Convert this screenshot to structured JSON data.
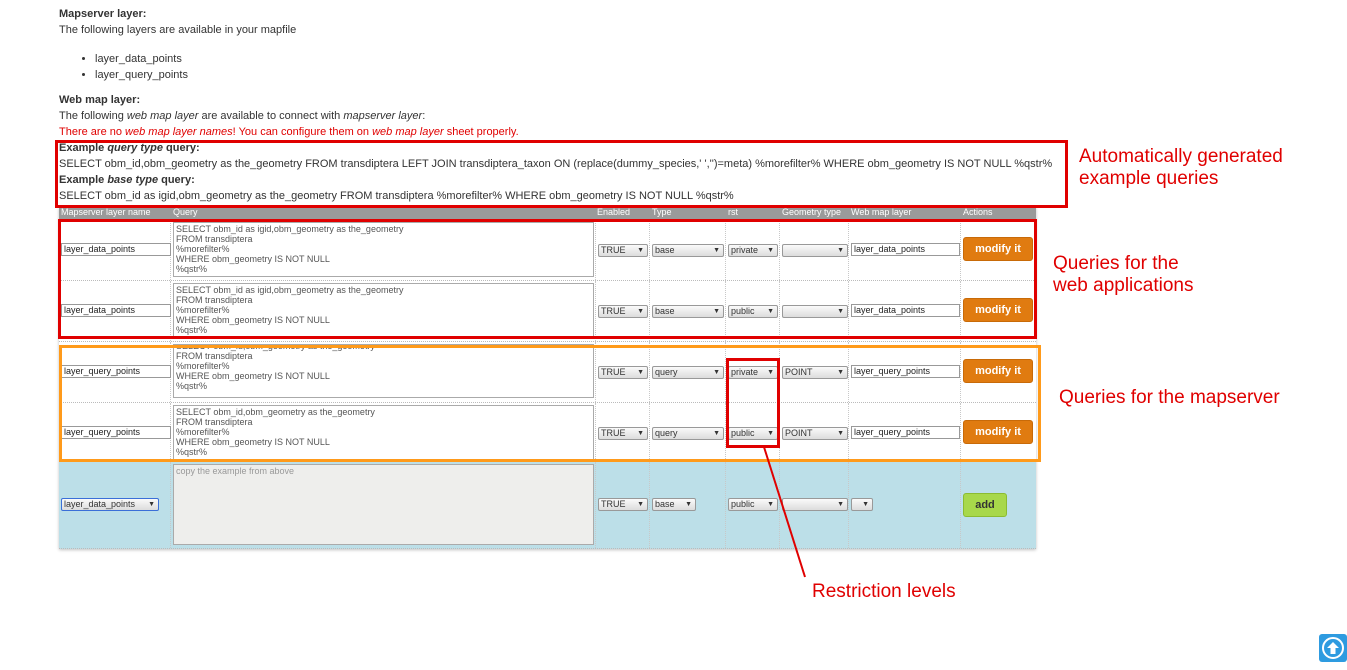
{
  "mapserver": {
    "heading": "Mapserver layer:",
    "intro": "The following layers are available in your mapfile",
    "layers": [
      "layer_data_points",
      "layer_query_points"
    ]
  },
  "webmap": {
    "heading": "Web map layer:",
    "intro_a": "The following ",
    "intro_b": "web map layer",
    "intro_c": " are available to connect with ",
    "intro_d": "mapserver layer",
    "intro_e": ":",
    "warn_a": "There are no ",
    "warn_b": "web map layer names",
    "warn_c": "! You can configure them on ",
    "warn_d": "web map layer",
    "warn_e": " sheet properly."
  },
  "examples": {
    "query_label_a": "Example ",
    "query_label_b": "query type",
    "query_label_c": " query:",
    "query_sql": "SELECT obm_id,obm_geometry as the_geometry FROM transdiptera LEFT JOIN transdiptera_taxon ON (replace(dummy_species,' ','')=meta) %morefilter% WHERE obm_geometry IS NOT NULL %qstr%",
    "base_label_a": "Example ",
    "base_label_b": "base type",
    "base_label_c": " query:",
    "base_sql": "SELECT obm_id as igid,obm_geometry as the_geometry FROM transdiptera %morefilter% WHERE obm_geometry IS NOT NULL %qstr%"
  },
  "table": {
    "headers": [
      "Mapserver layer name",
      "Query",
      "Enabled",
      "Type",
      "rst",
      "Geometry type",
      "Web map layer",
      "Actions"
    ],
    "rows": [
      {
        "layer": "layer_data_points",
        "query": "SELECT obm_id as igid,obm_geometry as the_geometry\nFROM transdiptera\n%morefilter%\nWHERE obm_geometry IS NOT NULL\n%qstr%",
        "enabled": "TRUE",
        "type": "base",
        "rst": "private",
        "geom": "",
        "webmap": "layer_data_points",
        "action": "modify it"
      },
      {
        "layer": "layer_data_points",
        "query": "SELECT obm_id as igid,obm_geometry as the_geometry\nFROM transdiptera\n%morefilter%\nWHERE obm_geometry IS NOT NULL\n%qstr%",
        "enabled": "TRUE",
        "type": "base",
        "rst": "public",
        "geom": "",
        "webmap": "layer_data_points",
        "action": "modify it"
      },
      {
        "layer": "layer_query_points",
        "query": "SELECT obm_id,obm_geometry as the_geometry\nFROM transdiptera\n%morefilter%\nWHERE obm_geometry IS NOT NULL\n%qstr%",
        "enabled": "TRUE",
        "type": "query",
        "rst": "private",
        "geom": "POINT",
        "webmap": "layer_query_points",
        "action": "modify it"
      },
      {
        "layer": "layer_query_points",
        "query": "SELECT obm_id,obm_geometry as the_geometry\nFROM transdiptera\n%morefilter%\nWHERE obm_geometry IS NOT NULL\n%qstr%",
        "enabled": "TRUE",
        "type": "query",
        "rst": "public",
        "geom": "POINT",
        "webmap": "layer_query_points",
        "action": "modify it"
      }
    ],
    "add_row": {
      "layer": "layer_data_points",
      "placeholder": "copy the example from above",
      "enabled": "TRUE",
      "type": "base",
      "rst": "public",
      "geom": "",
      "webmap": "",
      "action": "add"
    }
  },
  "annotations": {
    "auto_1": "Automatically generated",
    "auto_2": "example queries",
    "web_1": "Queries for the",
    "web_2": "web applications",
    "mapserver": "Queries for the mapserver",
    "restriction": "Restriction levels"
  },
  "colors": {
    "annotation": "#e00000",
    "orange_box": "#ff9a1a",
    "button": "#e07b10",
    "add_row": "#bcdfe8"
  },
  "icons": {
    "scroll_top": "arrow-up-icon",
    "select": "triangle-down-icon"
  }
}
